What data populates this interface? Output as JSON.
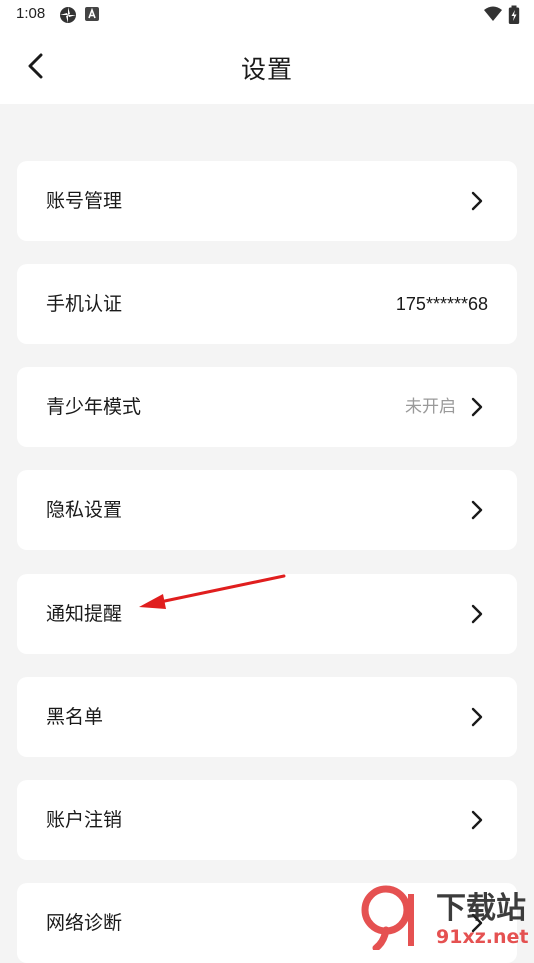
{
  "status_bar": {
    "time": "1:08"
  },
  "header": {
    "title": "设置"
  },
  "settings": {
    "items": [
      {
        "label": "账号管理"
      },
      {
        "label": "手机认证",
        "value": "175******68"
      },
      {
        "label": "青少年模式",
        "status": "未开启"
      },
      {
        "label": "隐私设置"
      },
      {
        "label": "通知提醒"
      },
      {
        "label": "黑名单"
      },
      {
        "label": "账户注销"
      },
      {
        "label": "网络诊断"
      }
    ]
  },
  "watermark": {
    "brand": "下载站",
    "domain": "91xz.net"
  },
  "colors": {
    "background": "#f4f4f4",
    "card": "#ffffff",
    "arrow": "#e01e1e",
    "muted": "#9a9a9a"
  },
  "icons": [
    "back-arrow-icon",
    "chevron-right-icon",
    "wifi-icon",
    "battery-icon"
  ]
}
